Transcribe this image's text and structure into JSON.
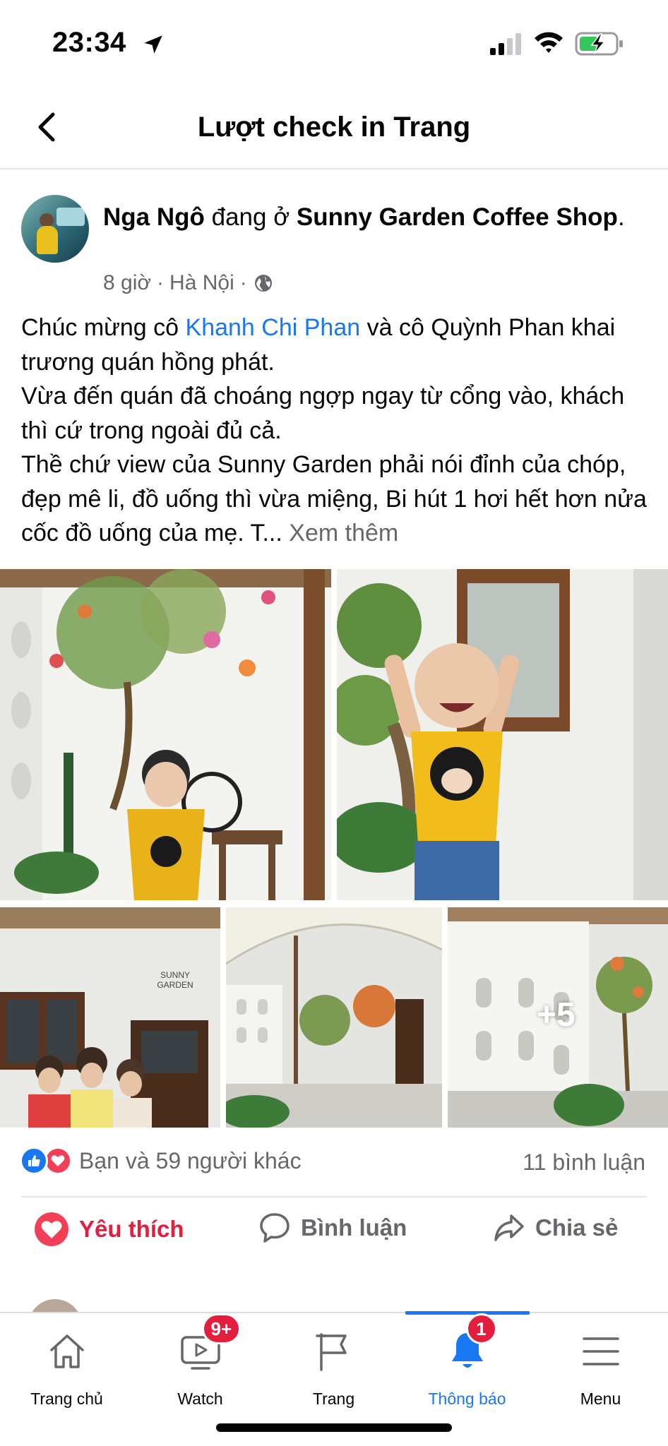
{
  "status_bar": {
    "time": "23:34"
  },
  "header": {
    "title": "Lượt check in Trang"
  },
  "post": {
    "author": "Nga Ngô",
    "action": "đang ở",
    "place": "Sunny Garden Coffee Shop",
    "time": "8 giờ",
    "location": "Hà Nội",
    "text_before_mention": "Chúc mừng cô ",
    "mention": "Khanh Chi Phan",
    "text_after_mention": " và cô Quỳnh Phan khai trương quán hồng phát.",
    "line2": "Vừa đến quán đã choáng ngợp ngay từ cổng vào, khách thì cứ trong ngoài đủ cả.",
    "line3": "Thề chứ view của Sunny Garden phải nói đỉnh của chóp, đẹp mê li, đồ uống thì vừa miệng, Bi hút 1 hơi hết hơn nửa cốc đồ uống của mẹ. T...",
    "see_more": "Xem thêm",
    "more_photos": "+5",
    "reactions_text": "Bạn và 59 người khác",
    "comments": "11 bình luận",
    "actions": {
      "like": "Yêu thích",
      "comment": "Bình luận",
      "share": "Chia sẻ"
    }
  },
  "tabbar": {
    "items": [
      {
        "label": "Trang chủ",
        "badge": ""
      },
      {
        "label": "Watch",
        "badge": "9+"
      },
      {
        "label": "Trang",
        "badge": ""
      },
      {
        "label": "Thông báo",
        "badge": "1"
      },
      {
        "label": "Menu",
        "badge": ""
      }
    ]
  },
  "colors": {
    "accent": "#1877f2",
    "like_red": "#e41e3f",
    "secondary_text": "#65676b"
  }
}
